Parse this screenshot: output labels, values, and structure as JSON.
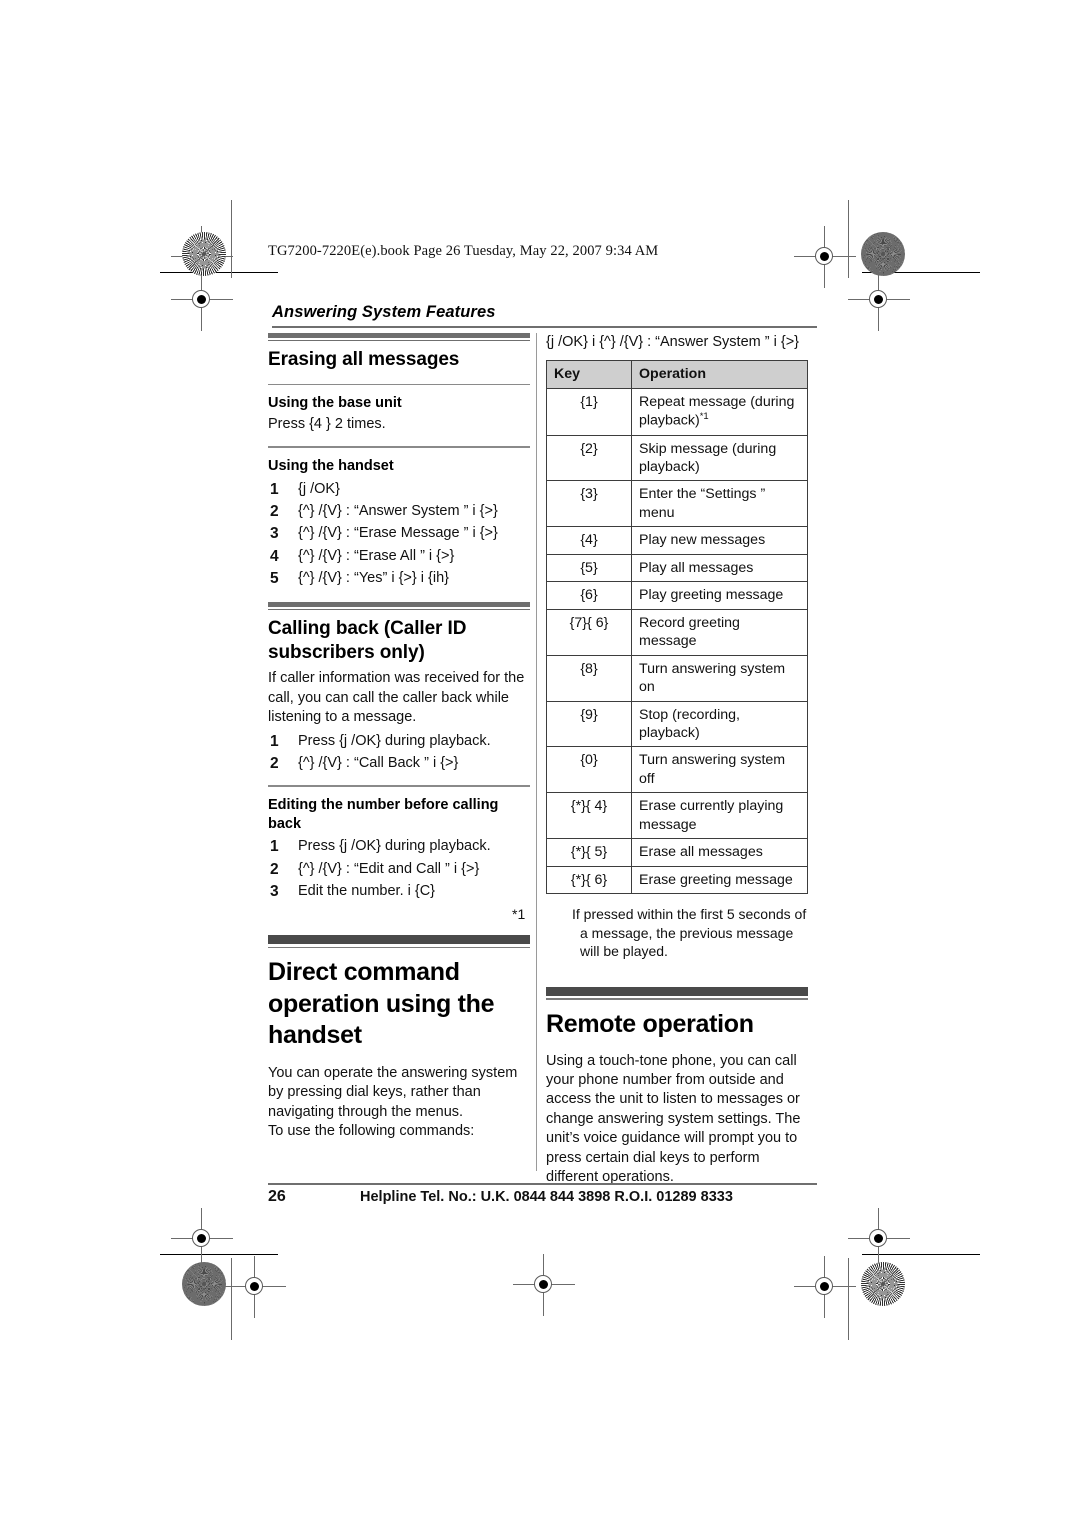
{
  "prepress": {
    "file_line": "TG7200-7220E(e).book  Page 26  Tuesday, May 22, 2007  9:34 AM"
  },
  "chapter_title": "Answering System Features",
  "left_column": {
    "section_erasing": {
      "heading": "Erasing all messages",
      "base_unit": {
        "subheading": "Using the base unit",
        "text": "Press {4 }  2 times."
      },
      "handset": {
        "subheading": "Using the handset",
        "steps": [
          "{j    /OK}",
          "{^} /{V} : “Answer System    ” i    {>}",
          "{^} /{V} : “Erase Message    ” i    {>}",
          "{^} /{V} : “Erase All     ” i      {>}",
          "{^} /{V} : “Yes” i      {>} i      {ih}"
        ]
      }
    },
    "section_calling_back": {
      "heading": "Calling back (Caller ID subscribers only)",
      "intro": "If caller information was received for the call, you can call the caller back while listening to a message.",
      "steps": [
        "Press {j    /OK}  during playback.",
        "{^} /{V} : “Call Back     ” i      {>}"
      ],
      "editing": {
        "subheading": "Editing the number before calling back",
        "steps": [
          "Press {j    /OK}  during playback.",
          "{^} /{V} : “Edit and Call       ” i    {>}",
          "Edit the number. i     {C}"
        ]
      }
    },
    "section_direct_command": {
      "heading": "Direct command operation using the handset",
      "paragraphs": [
        "You can operate the answering system by pressing dial keys, rather than navigating through the menus.",
        "To use the following commands:"
      ]
    }
  },
  "right_column": {
    "lead_in": "{j    /OK} i      {^} /{V} : “Answer System ” i      {>}",
    "table": {
      "headers": [
        "Key",
        "Operation"
      ],
      "rows": [
        {
          "key_prefix": "{",
          "key": "1",
          "key_suffix": "}",
          "key_text": "{1}",
          "operation": "Repeat message (during playback)",
          "footnote": "*1"
        },
        {
          "key_text": "{2}",
          "operation": "Skip message (during playback)",
          "footnote": ""
        },
        {
          "key_text": "{3}",
          "operation": "Enter the “Settings    ” menu",
          "footnote": ""
        },
        {
          "key_text": "{4}",
          "operation": "Play new messages",
          "footnote": ""
        },
        {
          "key_text": "{5}",
          "operation": "Play all messages",
          "footnote": ""
        },
        {
          "key_text": "{6}",
          "operation": "Play greeting message",
          "footnote": ""
        },
        {
          "key_text": "{7}{ 6}",
          "operation": "Record greeting message",
          "footnote": ""
        },
        {
          "key_text": "{8}",
          "operation": "Turn answering system on",
          "footnote": ""
        },
        {
          "key_text": "{9}",
          "operation": "Stop (recording, playback)",
          "footnote": ""
        },
        {
          "key_text": "{0}",
          "operation": "Turn answering system off",
          "footnote": ""
        },
        {
          "key_text": "{*}{  4}",
          "operation": "Erase currently playing message",
          "footnote": ""
        },
        {
          "key_text": "{*}{  5}",
          "operation": "Erase all messages",
          "footnote": ""
        },
        {
          "key_text": "{*}{  6}",
          "operation": "Erase greeting message",
          "footnote": ""
        }
      ]
    },
    "footnote": {
      "mark": "*1",
      "text": "If pressed within the first 5 seconds of a message, the previous message will be played."
    },
    "section_remote": {
      "heading": "Remote operation",
      "paragraph": "Using a touch-tone phone, you can call your phone number from outside and access the unit to listen to messages or change answering system settings. The unit’s voice guidance will prompt you to press certain dial keys to perform different operations."
    }
  },
  "footer": {
    "page_number": "26",
    "helpline": "Helpline Tel. No.: U.K. 0844 844 3898 R.O.I. 01289 8333"
  }
}
